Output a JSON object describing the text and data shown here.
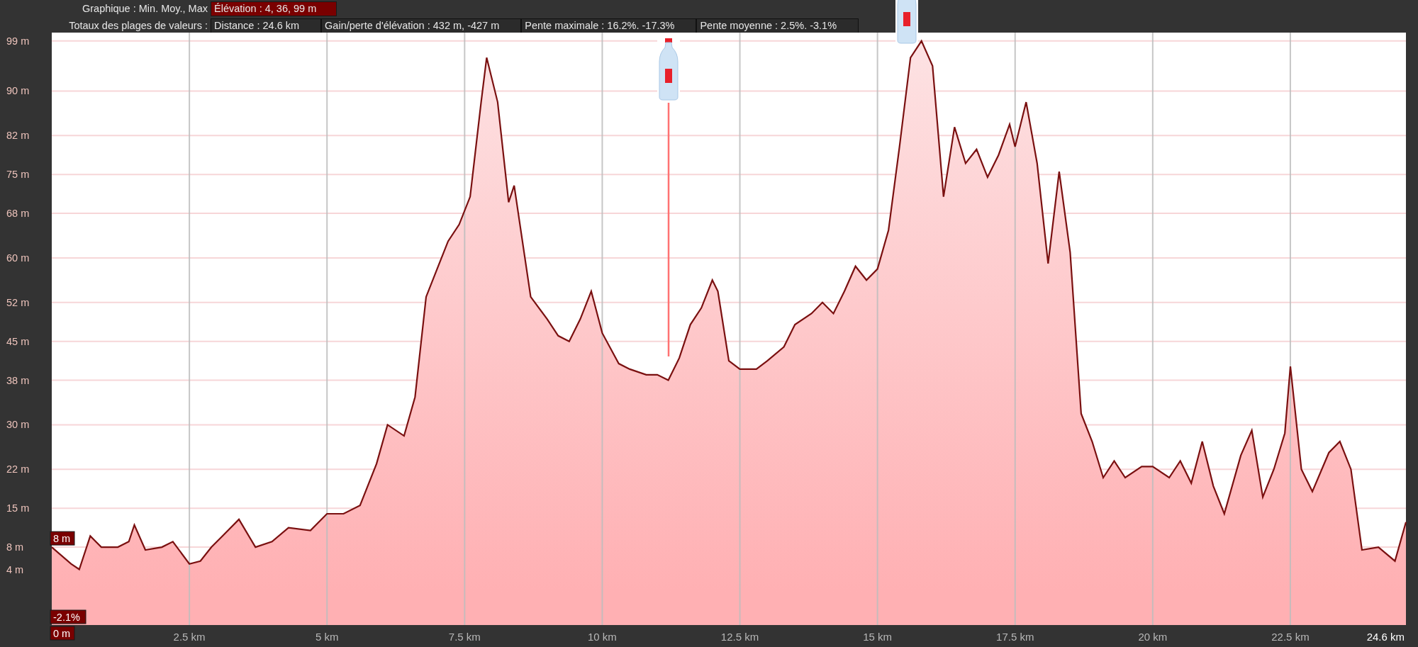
{
  "header": {
    "chart_label": "Graphique : Min. Moy., Max",
    "chart_value": "Élévation : 4, 36, 99 m",
    "totals_label": "Totaux des plages de valeurs :",
    "totals": [
      "Distance : 24.6 km",
      "Gain/perte d'élévation : 432 m, -427 m",
      "Pente maximale : 16.2%. -17.3%",
      "Pente moyenne : 2.5%. -3.1%"
    ]
  },
  "readouts": [
    {
      "kind": "elevation",
      "text": "8 m"
    },
    {
      "kind": "slope",
      "text": "-2.1%"
    },
    {
      "kind": "distance",
      "text": "0 m"
    }
  ],
  "chart_data": {
    "type": "area",
    "x": [
      0,
      0.35,
      0.5,
      0.7,
      0.9,
      1.2,
      1.4,
      1.5,
      1.7,
      2.0,
      2.2,
      2.5,
      2.7,
      2.9,
      3.1,
      3.4,
      3.7,
      4.0,
      4.3,
      4.7,
      5.0,
      5.3,
      5.6,
      5.9,
      6.1,
      6.4,
      6.6,
      6.8,
      7.0,
      7.2,
      7.4,
      7.6,
      7.8,
      7.9,
      8.1,
      8.3,
      8.4,
      8.7,
      9.0,
      9.2,
      9.4,
      9.6,
      9.8,
      10.0,
      10.3,
      10.5,
      10.8,
      11.0,
      11.2,
      11.4,
      11.6,
      11.8,
      12.0,
      12.1,
      12.3,
      12.5,
      12.8,
      13.0,
      13.3,
      13.5,
      13.8,
      14.0,
      14.2,
      14.4,
      14.6,
      14.8,
      15.0,
      15.2,
      15.4,
      15.6,
      15.8,
      16.0,
      16.2,
      16.4,
      16.6,
      16.8,
      17.0,
      17.2,
      17.4,
      17.5,
      17.7,
      17.9,
      18.1,
      18.3,
      18.5,
      18.7,
      18.9,
      19.1,
      19.3,
      19.5,
      19.8,
      20.0,
      20.3,
      20.5,
      20.7,
      20.9,
      21.1,
      21.3,
      21.6,
      21.8,
      22.0,
      22.2,
      22.4,
      22.5,
      22.7,
      22.9,
      23.2,
      23.4,
      23.6,
      23.8,
      24.1,
      24.4,
      24.6
    ],
    "series": [
      {
        "color": "#7a1010",
        "values": [
          8,
          5,
          4,
          10,
          8,
          8,
          9,
          12,
          7.5,
          8,
          9,
          5,
          5.5,
          8,
          10,
          13,
          8,
          9,
          11.5,
          11,
          14,
          14,
          15.5,
          23,
          30,
          28,
          35,
          53,
          58,
          63,
          66,
          71,
          88,
          96,
          88,
          70,
          73,
          53,
          49,
          46,
          45,
          49,
          54,
          46.5,
          41,
          40,
          39,
          39,
          38,
          42,
          48,
          51,
          56,
          54,
          41.5,
          40,
          40,
          41.5,
          44,
          48,
          50,
          52,
          50,
          54,
          58.5,
          56,
          58,
          65,
          80,
          96,
          99,
          94.5,
          71,
          83.5,
          77,
          79.5,
          74.5,
          78.5,
          84,
          80,
          88,
          77,
          59,
          75.5,
          61,
          32,
          27,
          20.5,
          23.5,
          20.5,
          22.5,
          22.5,
          20.5,
          23.5,
          19.5,
          27,
          19,
          14,
          24.5,
          29,
          17,
          22,
          28.5,
          40.5,
          22,
          18,
          25,
          27,
          22,
          7.5,
          8,
          5.5,
          12.5
        ]
      }
    ],
    "xlim": [
      0,
      24.6
    ],
    "ylim": [
      -6,
      100.5
    ],
    "xticks": [
      {
        "value": 2.5,
        "label": "2.5 km"
      },
      {
        "value": 5,
        "label": "5 km"
      },
      {
        "value": 7.5,
        "label": "7.5 km"
      },
      {
        "value": 10,
        "label": "10 km"
      },
      {
        "value": 12.5,
        "label": "12.5 km"
      },
      {
        "value": 15,
        "label": "15 km"
      },
      {
        "value": 17.5,
        "label": "17.5 km"
      },
      {
        "value": 20,
        "label": "20 km"
      },
      {
        "value": 22.5,
        "label": "22.5 km"
      },
      {
        "value": 24.6,
        "label": "24.6 km"
      }
    ],
    "yticks": [
      {
        "value": 99,
        "label": "99 m"
      },
      {
        "value": 90,
        "label": "90 m"
      },
      {
        "value": 82,
        "label": "82 m"
      },
      {
        "value": 75,
        "label": "75 m"
      },
      {
        "value": 68,
        "label": "68 m"
      },
      {
        "value": 60,
        "label": "60 m"
      },
      {
        "value": 52,
        "label": "52 m"
      },
      {
        "value": 45,
        "label": "45 m"
      },
      {
        "value": 38,
        "label": "38 m"
      },
      {
        "value": 30,
        "label": "30 m"
      },
      {
        "value": 22,
        "label": "22 m"
      },
      {
        "value": 15,
        "label": "15 m"
      },
      {
        "value": 8,
        "label": "8 m"
      },
      {
        "value": 4,
        "label": "4 m"
      }
    ],
    "grid": true,
    "bands": [
      {
        "axis": "y",
        "from": -6,
        "to": 0,
        "color": "#ffb0b3"
      }
    ]
  },
  "markers": [
    {
      "kind": "bottle",
      "leader_line": true
    },
    {
      "kind": "bottle",
      "leader_line": false
    }
  ]
}
